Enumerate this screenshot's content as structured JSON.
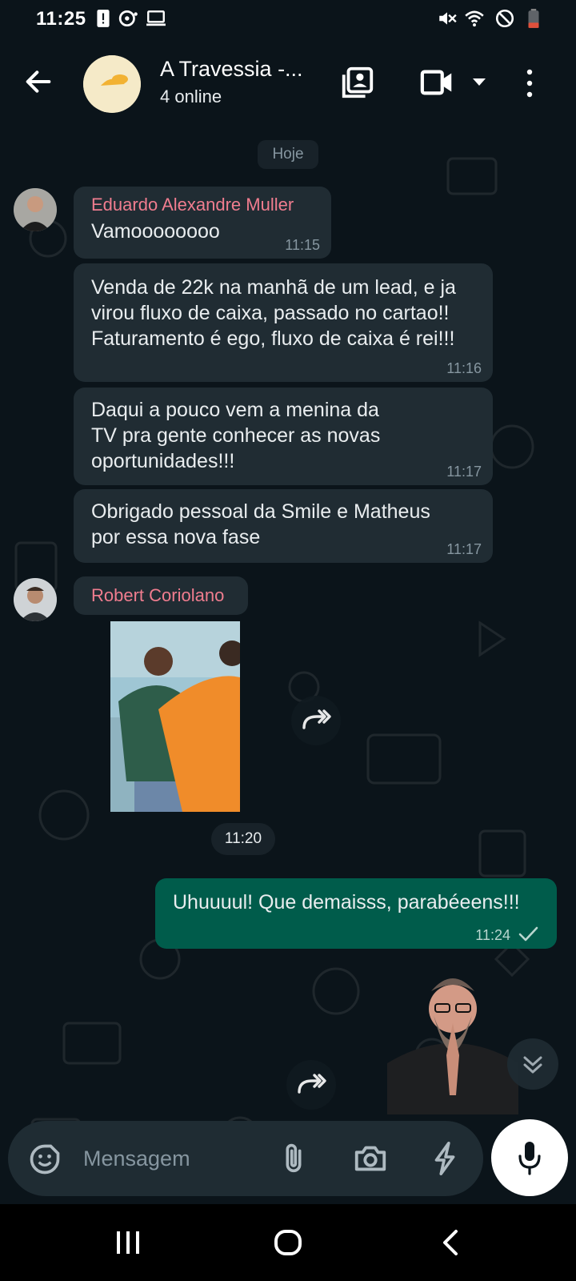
{
  "status_bar": {
    "time": "11:25",
    "icons_left": [
      "alert-icon",
      "podcast-icon",
      "laptop-icon"
    ],
    "icons_right": [
      "mute-icon",
      "wifi-icon",
      "do-not-disturb-icon",
      "battery-low-icon"
    ]
  },
  "header": {
    "title": "A Travessia -...",
    "subtitle": "4 online",
    "avatar_logo_text": "gorro amarelo"
  },
  "chat": {
    "date_label": "Hoje",
    "messages": [
      {
        "sender": "Eduardo Alexandre Muller",
        "text": "Vamoooooooo",
        "time": "11:15"
      },
      {
        "text": "Venda de 22k na manhã de um lead, e ja virou fluxo de caixa, passado no cartao!! Faturamento é ego, fluxo de caixa é rei!!!",
        "time": "11:16"
      },
      {
        "text": "Daqui a pouco vem a menina da TV pra gente conhecer as novas oportunidades!!!",
        "time": "11:17"
      },
      {
        "text": "Obrigado pessoal da Smile e Matheus por essa nova fase",
        "time": "11:17"
      },
      {
        "sender": "Robert Coriolano",
        "time": "11:20"
      },
      {
        "text": "Uhuuuul! Que demaisss, parabéeens!!!",
        "time": "11:24"
      }
    ]
  },
  "input": {
    "placeholder": "Mensagem"
  },
  "colors": {
    "background": "#0b141a",
    "incoming_bubble": "#202c33",
    "outgoing_bubble": "#005c4b",
    "sender_name": "#f07d8f",
    "timestamp": "#8696a0"
  }
}
